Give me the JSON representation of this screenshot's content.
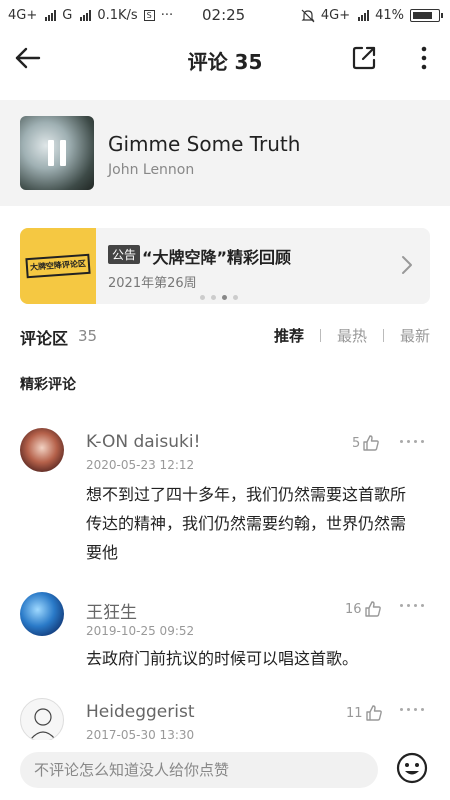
{
  "status_bar": {
    "net1": "4G+",
    "net2": "G",
    "speed": "0.1K/s",
    "s_badge": "S",
    "ellipsis": "···",
    "time": "02:25",
    "net_right": "4G+",
    "battery": "41%"
  },
  "header": {
    "title": "评论 35"
  },
  "song": {
    "name": "Gimme Some Truth",
    "artist": "John Lennon"
  },
  "banner": {
    "logo_text": "大牌空降评论区",
    "badge": "公告",
    "title": "“大牌空降”精彩回顾",
    "subtitle": "2021年第26周"
  },
  "comments_header": {
    "label": "评论区",
    "count": "35",
    "sort_options": [
      "推荐",
      "最热",
      "最新"
    ],
    "active_sort": "推荐"
  },
  "section_label": "精彩评论",
  "comments": [
    {
      "name": "K-ON daisuki!",
      "date": "2020-05-23 12:12",
      "likes": "5",
      "text": "想不到过了四十多年，我们仍然需要这首歌所传达的精神，我们仍然需要约翰，世界仍然需要他"
    },
    {
      "name": "王狂生",
      "date": "2019-10-25 09:52",
      "likes": "16",
      "text": "去政府门前抗议的时候可以唱这首歌。"
    },
    {
      "name": "Heideggerist",
      "date": "2017-05-30 13:30",
      "likes": "11",
      "text": ""
    }
  ],
  "input": {
    "placeholder": "不评论怎么知道没人给你点赞"
  }
}
